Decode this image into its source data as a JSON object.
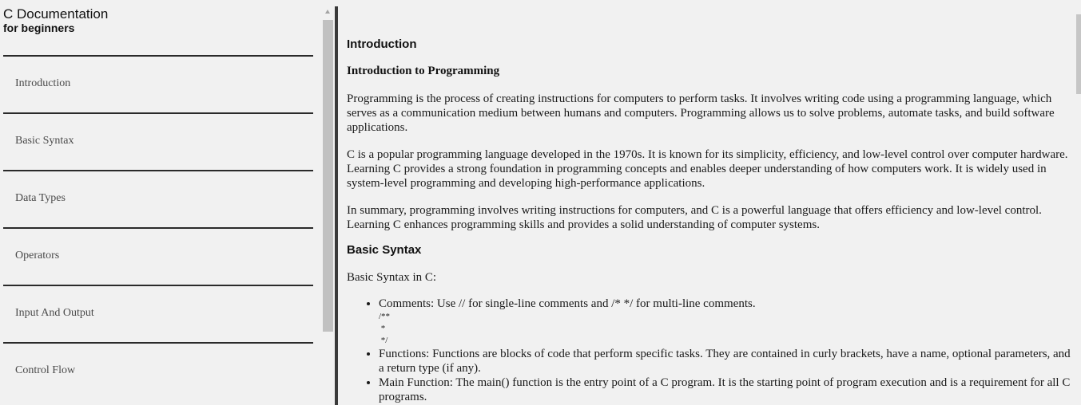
{
  "sidebar": {
    "title": "C Documentation",
    "subtitle": "for beginners",
    "items": [
      {
        "label": "Introduction"
      },
      {
        "label": "Basic Syntax"
      },
      {
        "label": "Data Types"
      },
      {
        "label": "Operators"
      },
      {
        "label": "Input And Output"
      },
      {
        "label": "Control Flow"
      }
    ]
  },
  "main": {
    "intro": {
      "heading": "Introduction",
      "subheading": "Introduction to Programming",
      "paragraphs": [
        "Programming is the process of creating instructions for computers to perform tasks. It involves writing code using a programming language, which serves as a communication medium between humans and computers. Programming allows us to solve problems, automate tasks, and build software applications.",
        "C is a popular programming language developed in the 1970s. It is known for its simplicity, efficiency, and low-level control over computer hardware. Learning C provides a strong foundation in programming concepts and enables deeper understanding of how computers work. It is widely used in system-level programming and developing high-performance applications.",
        "In summary, programming involves writing instructions for computers, and C is a powerful language that offers efficiency and low-level control. Learning C enhances programming skills and provides a solid understanding of computer systems."
      ]
    },
    "basic_syntax": {
      "heading": "Basic Syntax",
      "intro": "Basic Syntax in C:",
      "items": [
        {
          "text": "Comments: Use // for single-line comments and /* */ for multi-line comments.",
          "code": "/**\n *\n */"
        },
        {
          "text": "Functions: Functions are blocks of code that perform specific tasks. They are contained in curly brackets, have a name, optional parameters, and a return type (if any)."
        },
        {
          "text": "Main Function: The main() function is the entry point of a C program. It is the starting point of program execution and is a requirement for all C programs."
        }
      ]
    }
  }
}
